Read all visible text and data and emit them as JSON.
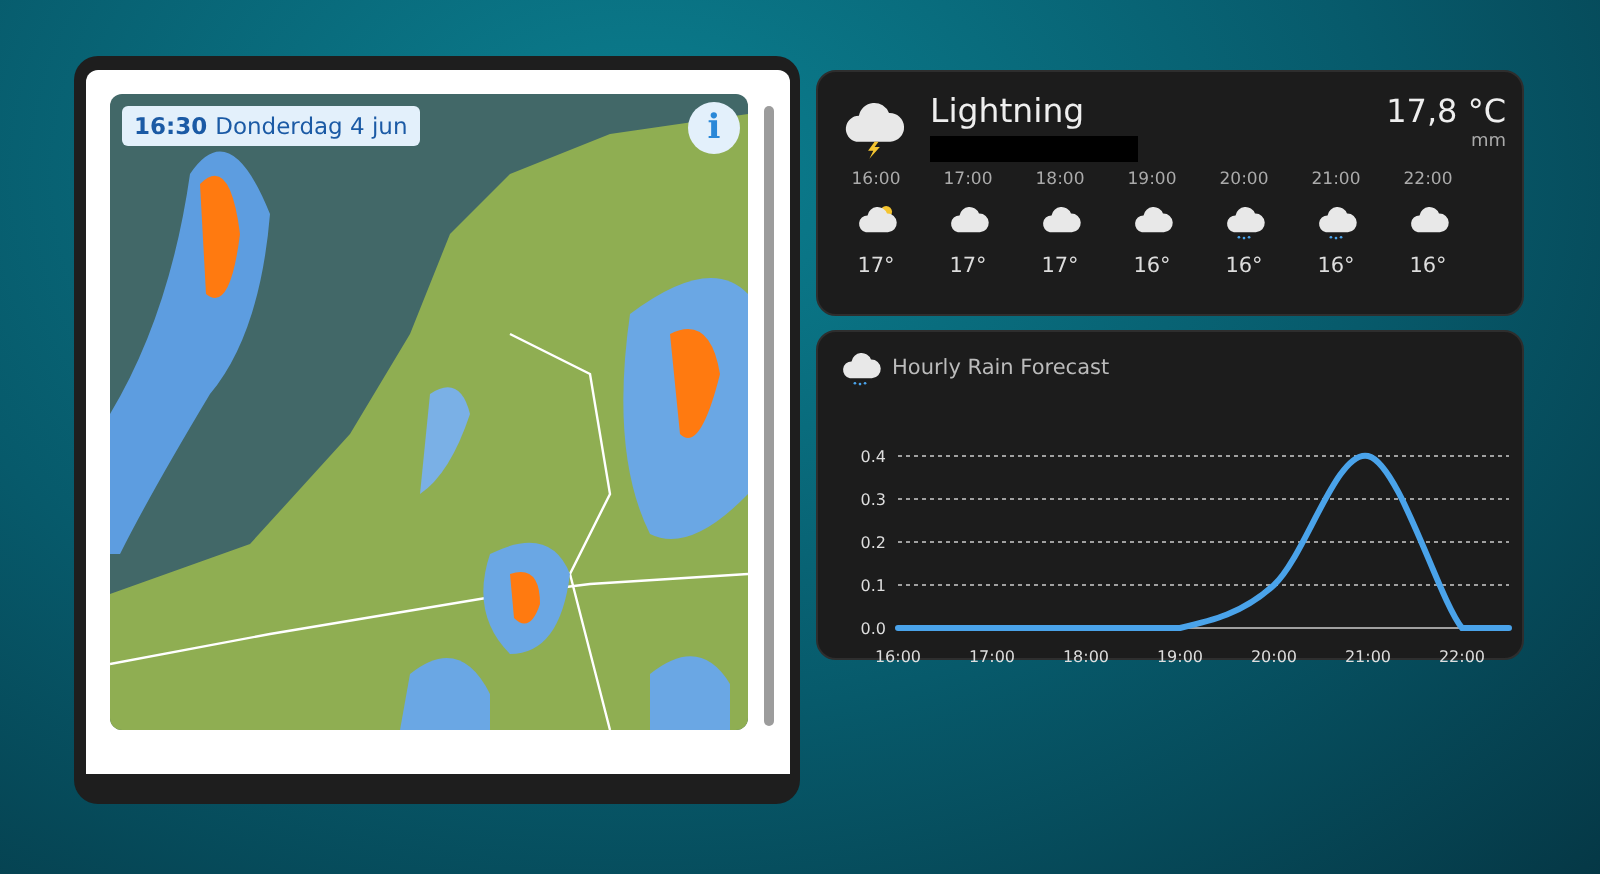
{
  "radar": {
    "timestamp_time": "16:30",
    "timestamp_date": "Donderdag 4 jun",
    "info": "i"
  },
  "weather": {
    "condition": "Lightning",
    "temperature": "17,8 °C",
    "unit": "mm",
    "kind": "lightning",
    "hourly": [
      {
        "time": "16:00",
        "kind": "partly-sunny",
        "temp": "17°"
      },
      {
        "time": "17:00",
        "kind": "cloudy",
        "temp": "17°"
      },
      {
        "time": "18:00",
        "kind": "cloudy",
        "temp": "17°"
      },
      {
        "time": "19:00",
        "kind": "cloudy",
        "temp": "16°"
      },
      {
        "time": "20:00",
        "kind": "rainy",
        "temp": "16°"
      },
      {
        "time": "21:00",
        "kind": "rainy",
        "temp": "16°"
      },
      {
        "time": "22:00",
        "kind": "cloudy",
        "temp": "16°"
      }
    ]
  },
  "rain_card": {
    "title": "Hourly Rain Forecast",
    "chart_data": {
      "type": "line",
      "x": [
        16,
        17,
        18,
        19,
        20,
        21,
        22,
        22.5
      ],
      "xticks": [
        {
          "value": 16,
          "label": "16:00"
        },
        {
          "value": 17,
          "label": "17:00"
        },
        {
          "value": 18,
          "label": "18:00"
        },
        {
          "value": 19,
          "label": "19:00"
        },
        {
          "value": 20,
          "label": "20:00"
        },
        {
          "value": 21,
          "label": "21:00"
        },
        {
          "value": 22,
          "label": "22:00"
        }
      ],
      "grid": true,
      "xlim": [
        16,
        22.5
      ],
      "series": [
        {
          "color": "#4aa3ea",
          "values": [
            0,
            0,
            0,
            0,
            0.1,
            0.4,
            0,
            0
          ]
        }
      ],
      "ylim": [
        0,
        0.4
      ],
      "yticks": [
        {
          "value": 0,
          "label": "0.0"
        },
        {
          "value": 0.1,
          "label": "0.1"
        },
        {
          "value": 0.2,
          "label": "0.2"
        },
        {
          "value": 0.3,
          "label": "0.3"
        },
        {
          "value": 0.4,
          "label": "0.4"
        }
      ]
    }
  }
}
